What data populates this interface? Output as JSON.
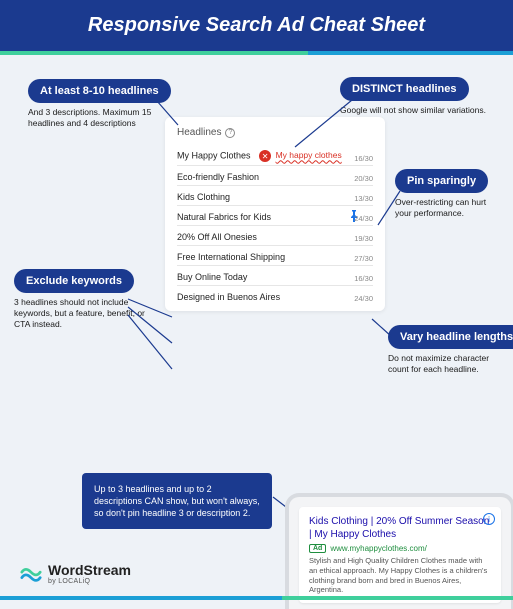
{
  "header": {
    "title": "Responsive Search Ad Cheat Sheet"
  },
  "callouts": {
    "headlines_count": {
      "pill": "At least 8-10 headlines",
      "text": "And 3 descriptions. Maximum 15 headlines and 4 descriptions"
    },
    "distinct": {
      "pill": "DISTINCT headlines",
      "text": "Google will not show similar variations."
    },
    "pin": {
      "pill": "Pin sparingly",
      "text": "Over-restricting can hurt your performance."
    },
    "exclude": {
      "pill": "Exclude keywords",
      "text": "3 headlines should not include keywords, but a feature, benefit, or CTA instead."
    },
    "vary": {
      "pill": "Vary headline lengths",
      "text": "Do not maximize character count for each headline."
    }
  },
  "panel": {
    "title": "Headlines",
    "rows": [
      {
        "label": "My Happy Clothes",
        "count": "16/30",
        "error_text": "My happy clothes"
      },
      {
        "label": "Eco-friendly Fashion",
        "count": "20/30"
      },
      {
        "label": "Kids Clothing",
        "count": "13/30"
      },
      {
        "label": "Natural Fabrics for Kids",
        "count": "24/30",
        "pin": true
      },
      {
        "label": "20% Off All Onesies",
        "count": "19/30"
      },
      {
        "label": "Free International Shipping",
        "count": "27/30"
      },
      {
        "label": "Buy Online Today",
        "count": "16/30"
      },
      {
        "label": "Designed in Buenos Aires",
        "count": "24/30"
      }
    ]
  },
  "note": "Up to 3 headlines and up to 2 descriptions CAN show, but won't always, so don't pin headline 3 or description 2.",
  "ad": {
    "title": "Kids Clothing | 20% Off Summer Season | My Happy Clothes",
    "badge": "Ad",
    "url": "www.myhappyclothes.com/",
    "desc": "Stylish and High Quality Children Clothes made with an ethical approach. My Happy Clothes is a children's clothing brand born and bred in Buenos Aires, Argentina."
  },
  "footer": {
    "brand": "WordStream",
    "sub": "by LOCALiQ"
  }
}
